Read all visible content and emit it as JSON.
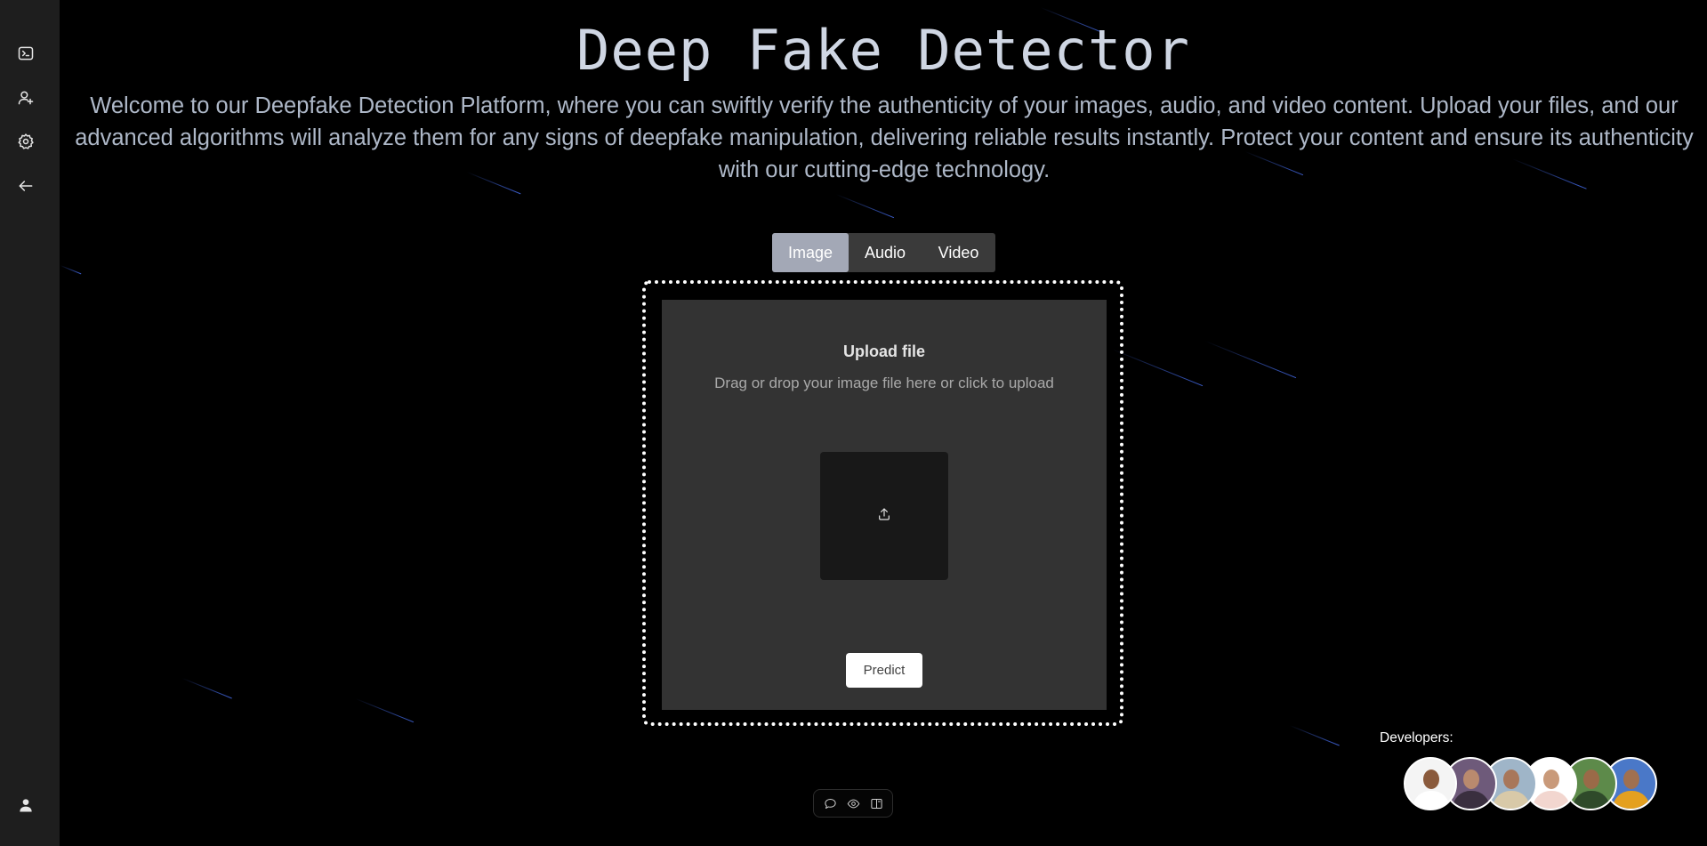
{
  "app": {
    "title": "Deep Fake Detector",
    "description": "Welcome to our Deepfake Detection Platform, where you can swiftly verify the authenticity of your images, audio, and video content. Upload your files, and our advanced algorithms will analyze them for any signs of deepfake manipulation, delivering reliable results instantly. Protect your content and ensure its authenticity with our cutting-edge technology."
  },
  "sidebar": {
    "items": [
      {
        "icon": "terminal-icon"
      },
      {
        "icon": "user-add-icon"
      },
      {
        "icon": "gear-icon"
      },
      {
        "icon": "arrow-left-icon"
      }
    ],
    "footer_icon": "user-icon"
  },
  "tabs": [
    {
      "label": "Image",
      "active": true
    },
    {
      "label": "Audio",
      "active": false
    },
    {
      "label": "Video",
      "active": false
    }
  ],
  "upload": {
    "title": "Upload file",
    "hint": "Drag or drop your image file here or click to upload",
    "icon": "upload-icon",
    "predict_label": "Predict"
  },
  "toolbar": {
    "icons": [
      "comment-icon",
      "eye-icon",
      "panel-icon"
    ]
  },
  "developers": {
    "label": "Developers:",
    "avatars": [
      {
        "bg": "#f4f4f4",
        "skin": "#8a5a3c",
        "cloth": "#ffffff"
      },
      {
        "bg": "#6e5a7a",
        "skin": "#b98a6e",
        "cloth": "#3a2f3f"
      },
      {
        "bg": "#9fb5c8",
        "skin": "#a8775a",
        "cloth": "#d8c9a8"
      },
      {
        "bg": "#ffffff",
        "skin": "#c99a7a",
        "cloth": "#f2d6cf"
      },
      {
        "bg": "#5d8a4a",
        "skin": "#9a6a48",
        "cloth": "#2f4a2a"
      },
      {
        "bg": "#4a78c8",
        "skin": "#a07050",
        "cloth": "#e4a020"
      }
    ]
  },
  "colors": {
    "background": "#000000",
    "sidebar": "#1e1e1e",
    "active_tab": "#a3a8b6",
    "panel": "#333333"
  }
}
